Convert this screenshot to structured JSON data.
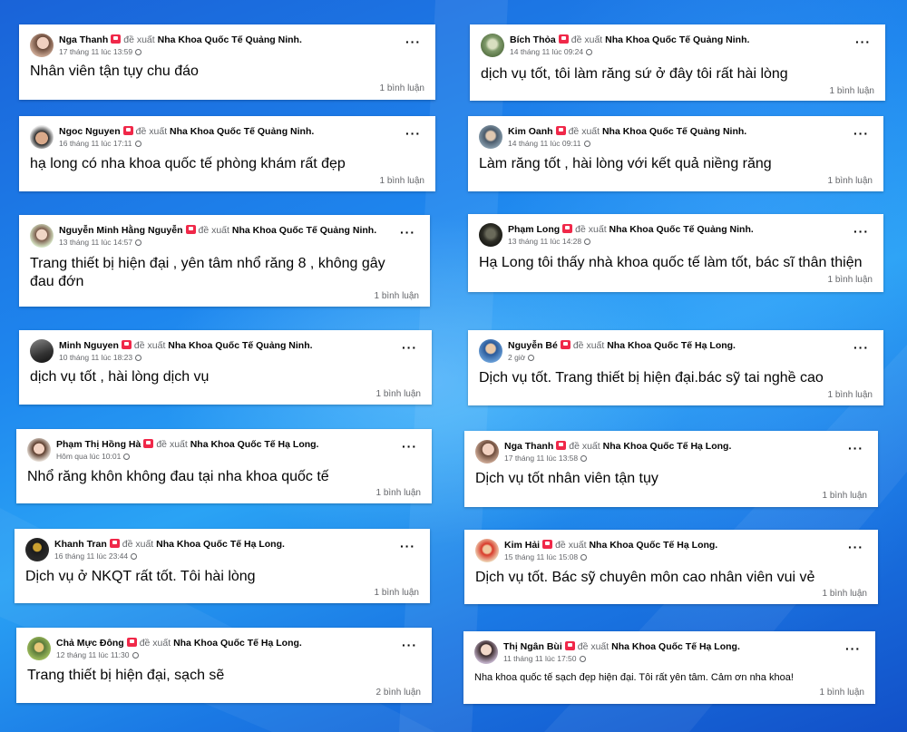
{
  "recommend_text": "đề xuất",
  "posts": [
    {
      "author": "Nga Thanh",
      "page": "Nha Khoa Quốc Tế Quảng Ninh.",
      "time": "17 tháng 11 lúc 13:59",
      "text": "Nhân viên tận tụy chu đáo",
      "comments": "1 bình luận"
    },
    {
      "author": "Bích Thỏa",
      "page": "Nha Khoa Quốc Tế Quảng Ninh.",
      "time": "14 tháng 11 lúc 09:24",
      "text": "dịch vụ tốt, tôi làm răng sứ ở đây tôi rất hài lòng",
      "comments": "1 bình luận"
    },
    {
      "author": "Ngoc Nguyen",
      "page": "Nha Khoa Quốc Tế Quảng Ninh.",
      "time": "16 tháng 11 lúc 17:11",
      "text": "hạ long có nha khoa quốc tế phòng khám rất đẹp",
      "comments": "1 bình luận"
    },
    {
      "author": "Kim Oanh",
      "page": "Nha Khoa Quốc Tế Quảng Ninh.",
      "time": "14 tháng 11 lúc 09:11",
      "text": "Làm răng tốt , hài lòng với kết quả niềng răng",
      "comments": "1 bình luận"
    },
    {
      "author": "Nguyễn Minh Hằng Nguyễn",
      "page": "Nha Khoa Quốc Tế Quảng Ninh.",
      "time": "13 tháng 11 lúc 14:57",
      "text": "Trang thiết bị hiện đại , yên tâm nhổ răng 8 , không gây đau đớn",
      "comments": "1 bình luận"
    },
    {
      "author": "Phạm Long",
      "page": "Nha Khoa Quốc Tế Quảng Ninh.",
      "time": "13 tháng 11 lúc 14:28",
      "text": "Hạ Long tôi thấy nhà khoa quốc tế làm tốt, bác sĩ thân thiện",
      "comments": "1 bình luận"
    },
    {
      "author": "Minh Nguyen",
      "page": "Nha Khoa Quốc Tế Quảng Ninh.",
      "time": "10 tháng 11 lúc 18:23",
      "text": "dịch vụ tốt , hài lòng dịch vụ",
      "comments": "1 bình luận"
    },
    {
      "author": "Nguyễn Bé",
      "page": "Nha Khoa Quốc Tế Hạ Long.",
      "time": "2 giờ",
      "text": "Dịch vụ tốt. Trang thiết bị hiện đại.bác sỹ tai nghề cao",
      "comments": "1 bình luận"
    },
    {
      "author": "Phạm Thị Hồng Hà",
      "page": "Nha Khoa Quốc Tế Hạ Long.",
      "time": "Hôm qua lúc 10:01",
      "text": "Nhổ răng khôn không đau tại nha khoa quốc tế",
      "comments": "1 bình luận"
    },
    {
      "author": "Nga Thanh",
      "page": "Nha Khoa Quốc Tế Hạ Long.",
      "time": "17 tháng 11 lúc 13:58",
      "text": "Dịch vụ tốt nhân viên tận tụy",
      "comments": "1 bình luận"
    },
    {
      "author": "Khanh Tran",
      "page": "Nha Khoa Quốc Tế Hạ Long.",
      "time": "16 tháng 11 lúc 23:44",
      "text": "Dịch vụ ở NKQT rất tốt. Tôi hài lòng",
      "comments": "1 bình luận"
    },
    {
      "author": "Kim Hải",
      "page": "Nha Khoa Quốc Tế Hạ Long.",
      "time": "15 tháng 11 lúc 15:08",
      "text": "Dịch vụ tốt. Bác sỹ chuyên môn cao nhân viên vui vẻ",
      "comments": "1 bình luận"
    },
    {
      "author": "Chả Mực Đông",
      "page": "Nha Khoa Quốc Tế Hạ Long.",
      "time": "12 tháng 11 lúc 11:30",
      "text": "Trang thiết bị hiện đại, sạch sẽ",
      "comments": "2 bình luận"
    },
    {
      "author": "Thị Ngân Bùi",
      "page": "Nha Khoa Quốc Tế Hạ Long.",
      "time": "11 tháng 11 lúc 17:50",
      "text": "Nha khoa quốc tế sạch đẹp hiện đại. Tôi rất yên tâm. Cảm ơn nha khoa!",
      "comments": "1 bình luận"
    }
  ],
  "colors": {
    "recommend_icon": "#f02849",
    "muted": "#65676b",
    "text": "#050505"
  }
}
